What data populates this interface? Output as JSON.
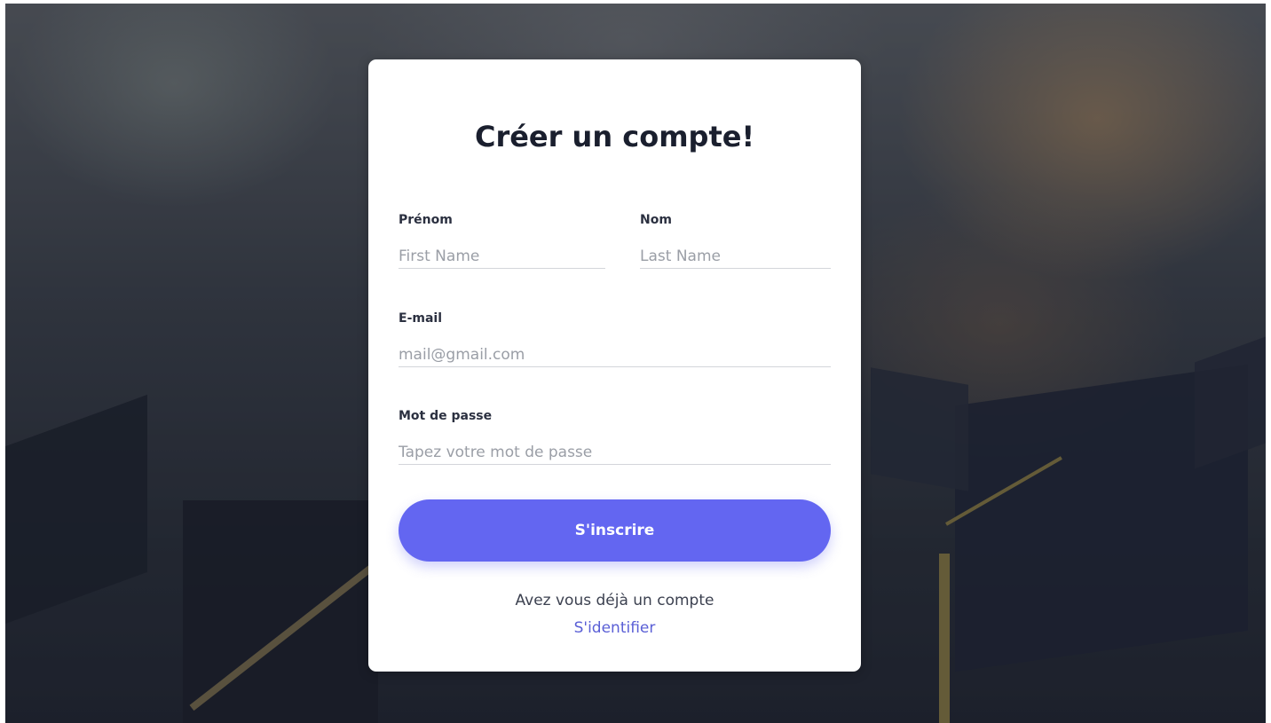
{
  "form": {
    "title": "Créer un compte!",
    "first_name": {
      "label": "Prénom",
      "placeholder": "First Name"
    },
    "last_name": {
      "label": "Nom",
      "placeholder": "Last Name"
    },
    "email": {
      "label": "E-mail",
      "placeholder": "mail@gmail.com"
    },
    "password": {
      "label": "Mot de passe",
      "placeholder": "Tapez votre mot de passe"
    },
    "submit_label": "S'inscrire",
    "login_prompt": "Avez vous déjà un compte",
    "login_link": "S'identifier"
  },
  "colors": {
    "accent": "#6366f1",
    "link": "#5a5fd6",
    "title": "#1a1f2e",
    "card": "#ffffff"
  }
}
